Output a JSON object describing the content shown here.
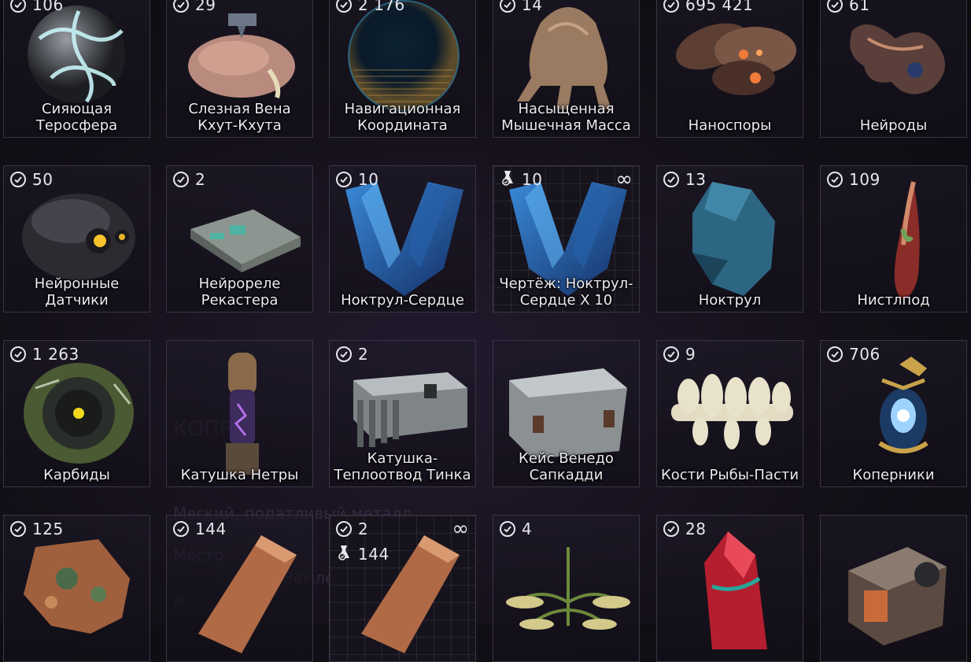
{
  "items": [
    {
      "name": "Сияющая Теросфера",
      "count": "106",
      "art": "sphere-gray"
    },
    {
      "name": "Слезная Вена Кхут-Кхута",
      "count": "29",
      "art": "flesh-blob"
    },
    {
      "name": "Навигационная Координата",
      "count": "2 176",
      "art": "nav-sphere"
    },
    {
      "name": "Насыщенная Мышечная Масса",
      "count": "14",
      "art": "muscle"
    },
    {
      "name": "Наноспоры",
      "count": "695 421",
      "art": "spores"
    },
    {
      "name": "Нейроды",
      "count": "61",
      "art": "neurode"
    },
    {
      "name": "Нейронные Датчики",
      "count": "50",
      "art": "sensor"
    },
    {
      "name": "Нейрореле Рекастера",
      "count": "2",
      "art": "relay"
    },
    {
      "name": "Ноктрул-Сердце",
      "count": "10",
      "art": "crystal-heart"
    },
    {
      "name": "Чертёж: Ноктрул-Сердце X 10",
      "count": "10",
      "art": "crystal-heart",
      "blueprint": true,
      "infinite": "∞"
    },
    {
      "name": "Ноктрул",
      "count": "13",
      "art": "noctrul"
    },
    {
      "name": "Нистлпод",
      "count": "109",
      "art": "nistlepod"
    },
    {
      "name": "Карбиды",
      "count": "1 263",
      "art": "carbide"
    },
    {
      "name": "Катушка Нетры",
      "count": "",
      "art": "coil"
    },
    {
      "name": "Катушка-Теплоотвод Тинка",
      "count": "2",
      "art": "heatsink"
    },
    {
      "name": "Кейс Венедо Сапкадди",
      "count": "",
      "art": "case"
    },
    {
      "name": "Кости Рыбы-Пасти",
      "count": "9",
      "art": "bones"
    },
    {
      "name": "Коперники",
      "count": "706",
      "art": "copernics"
    },
    {
      "name": "",
      "count": "125",
      "art": "copper-ore"
    },
    {
      "name": "",
      "count": "144",
      "art": "copper-bar"
    },
    {
      "name": "",
      "count": "2",
      "count2": "144",
      "art": "copper-bar",
      "blueprint": true,
      "infinite": "∞"
    },
    {
      "name": "",
      "count": "4",
      "art": "plant"
    },
    {
      "name": "",
      "count": "28",
      "art": "red-crystal"
    },
    {
      "name": "",
      "count": "",
      "art": "box-device"
    }
  ],
  "background_text": {
    "heading": "КОПР",
    "line1": "Мягкий, податливый металл",
    "line2": "Место",
    "line3": "Земле",
    "line4": "м"
  },
  "colors": {
    "card_border": "#3a3546",
    "text": "#ecebf0"
  },
  "icons": {
    "owned": "check-circle-icon",
    "kit": "blueprint-kit-icon",
    "infinite": "infinity-icon"
  }
}
